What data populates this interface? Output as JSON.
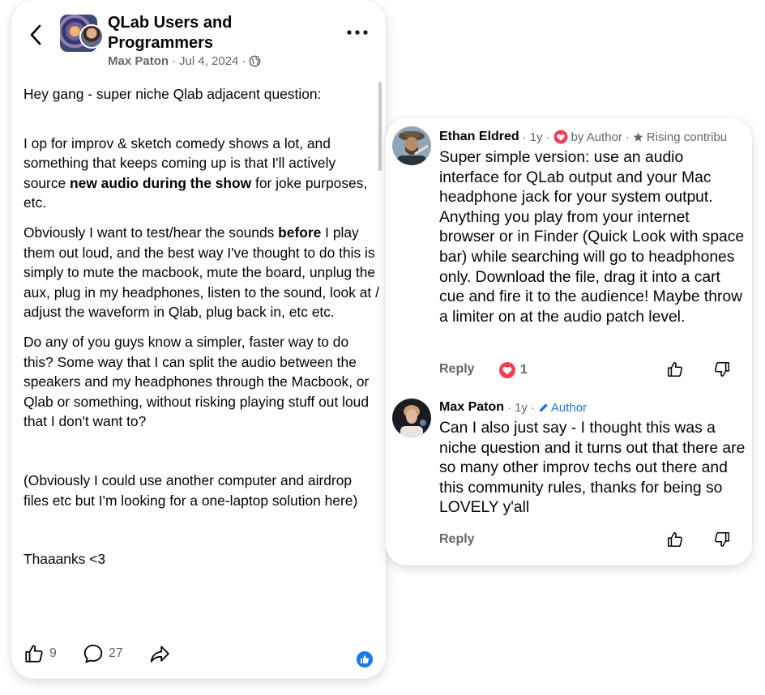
{
  "post": {
    "group_title": "QLab Users and Programmers",
    "author": "Max Paton",
    "date": "Jul 4, 2024",
    "separator": "·",
    "intro": "Hey gang - super niche Qlab adjacent question:",
    "p1_a": "I op for improv & sketch comedy shows a lot, and something that keeps coming up is that I'll actively source ",
    "p1_bold": "new audio during the show",
    "p1_b": " for joke purposes, etc.",
    "p2_a": "Obviously I want to test/hear the sounds ",
    "p2_bold": "before",
    "p2_b": " I play them out loud, and the best way I've thought to do this is simply to mute the macbook, mute the board, unplug the aux, plug in my headphones, listen to the sound, look at / adjust the waveform in Qlab, plug back in, etc etc.",
    "p3": "Do any of you guys know a simpler, faster way to do this? Some way that I can split the audio between the speakers and my headphones through the Macbook, or Qlab or something, without risking playing stuff out loud that I don't want to?",
    "p4": "(Obviously I could use another computer and airdrop files etc but I'm looking for a one-laptop solution here)",
    "p5": "Thaaanks <3",
    "like_count": "9",
    "comment_count": "27"
  },
  "comments": [
    {
      "name": "Ethan Eldred",
      "age": "1y",
      "badge_author": "by Author",
      "badge_rising": "Rising contribu",
      "text": "Super simple version: use an audio interface for QLab output and your Mac headphone jack for your system output. Anything you play from your internet browser or in Finder (Quick Look with space bar) while searching will go to headphones only. Download the file, drag it into a cart cue and fire it to the audience! Maybe throw a limiter on at the audio patch level.",
      "reply_label": "Reply",
      "reaction_count": "1"
    },
    {
      "name": "Max Paton",
      "age": "1y",
      "badge_author": "Author",
      "text": "Can I also just say - I thought this was a niche question and it turns out that there are so many other improv techs out there and this community rules, thanks for being so LOVELY y'all",
      "reply_label": "Reply"
    }
  ],
  "icons": {
    "back": "chevron-left-icon",
    "more": "more-dots-icon",
    "globe": "globe-icon",
    "like": "thumbs-up-icon",
    "comment": "comment-bubble-icon",
    "share": "share-arrow-icon",
    "heart": "heart-icon",
    "star": "star-icon",
    "pencil": "pencil-icon",
    "dislike": "thumbs-down-icon"
  },
  "colors": {
    "accent_blue": "#1877f2",
    "heart_red": "#f33e58",
    "muted_text": "#65676b"
  }
}
